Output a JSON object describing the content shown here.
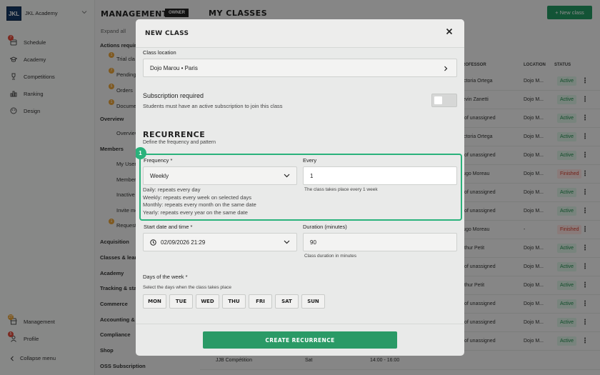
{
  "app": {
    "logo": "JKL",
    "name": "JKL Academy"
  },
  "sidebar": {
    "items": [
      {
        "label": "Schedule",
        "icon": "calendar-icon",
        "badge": "7"
      },
      {
        "label": "Academy",
        "icon": "graduation-cap-icon"
      },
      {
        "label": "Competitions",
        "icon": "trophy-icon"
      },
      {
        "label": "Ranking",
        "icon": "bar-chart-icon"
      },
      {
        "label": "Design",
        "icon": "palette-icon"
      }
    ],
    "bottom": [
      {
        "label": "Management",
        "icon": "store-icon",
        "badge": "27"
      },
      {
        "label": "Profile",
        "icon": "user-icon",
        "badge": "5"
      }
    ],
    "collapse": "Collapse menu"
  },
  "middle": {
    "title": "MANAGEMENT",
    "owner_badge": "OWNER",
    "expand": "Expand all",
    "sections": [
      {
        "label": "Actions required"
      },
      {
        "label": "Trial classes",
        "badge": "1"
      },
      {
        "label": "Pending",
        "badge": "7"
      },
      {
        "label": "Orders",
        "badge": "5"
      },
      {
        "label": "Documents",
        "badge": "1"
      },
      {
        "label": "Overview"
      },
      {
        "label": "Overview"
      },
      {
        "label": "Members"
      },
      {
        "label": "My Users"
      },
      {
        "label": "Members"
      },
      {
        "label": "Inactive members"
      },
      {
        "label": "Invite members"
      },
      {
        "label": "Requests",
        "badge": "1"
      },
      {
        "label": "Acquisition"
      },
      {
        "label": "Classes & learning"
      },
      {
        "label": "Academy"
      },
      {
        "label": "Tracking & stats"
      },
      {
        "label": "Commerce"
      },
      {
        "label": "Accounting & finance"
      },
      {
        "label": "Compliance"
      },
      {
        "label": "Shop"
      },
      {
        "label": "OSS Subscription"
      }
    ]
  },
  "main": {
    "title": "MY CLASSES",
    "new_button": "+ New class",
    "columns": [
      "PROFESSOR",
      "LOCATION",
      "STATUS"
    ],
    "rows": [
      {
        "prof": "Victoria Ortega",
        "loc": "Dojo M...",
        "status": "Active"
      },
      {
        "prof": "Kevin Zanetti",
        "loc": "Dojo M...",
        "status": "Active"
      },
      {
        "prof": "Prof unassigned",
        "loc": "Dojo M...",
        "status": "Active"
      },
      {
        "prof": "Victoria Ortega",
        "loc": "Dojo M...",
        "status": "Active"
      },
      {
        "prof": "Prof unassigned",
        "loc": "Dojo M...",
        "status": "Active"
      },
      {
        "prof": "Hugo Moreau",
        "loc": "Dojo M...",
        "status": "Finished"
      },
      {
        "prof": "Prof unassigned",
        "loc": "Dojo M...",
        "status": "Active"
      },
      {
        "prof": "Prof unassigned",
        "loc": "Dojo M...",
        "status": "Active"
      },
      {
        "prof": "Hugo Moreau",
        "loc": "-",
        "status": "Finished"
      },
      {
        "prof": "Arthur Petit",
        "loc": "Dojo M...",
        "status": "Active"
      },
      {
        "prof": "Prof unassigned",
        "loc": "Dojo M...",
        "status": "Active"
      },
      {
        "prof": "Arthur Petit",
        "loc": "Dojo M...",
        "status": "Active"
      },
      {
        "prof": "Prof unassigned",
        "loc": "Dojo M...",
        "status": "Active"
      },
      {
        "prof": "Prof unassigned",
        "loc": "Dojo M...",
        "status": "Active"
      },
      {
        "prof": "Prof unassigned",
        "loc": "Dojo M...",
        "status": "Active"
      }
    ],
    "last_row": {
      "name": "JJB Compétition",
      "day": "Sat",
      "time": "14:00 - 16:00"
    }
  },
  "modal": {
    "title": "NEW CLASS",
    "location_label": "Class location",
    "location_value": "Dojo Marou • Paris",
    "subscription_label": "Subscription required",
    "subscription_hint": "Students must have an active subscription to join this class",
    "recurrence_title": "RECURRENCE",
    "recurrence_sub": "Define the frequency and pattern",
    "step": "1",
    "frequency_label": "Frequency *",
    "frequency_value": "Weekly",
    "every_label": "Every",
    "every_value": "1",
    "every_hint": "The class takes place every 1 week",
    "freq_help": [
      "Daily: repeats every day",
      "Weekly: repeats every week on selected days",
      "Monthly: repeats every month on the same date",
      "Yearly: repeats every year on the same date"
    ],
    "start_label": "Start date and time *",
    "start_value": "02/09/2026 21:29",
    "duration_label": "Duration (minutes)",
    "duration_value": "90",
    "duration_hint": "Class duration in minutes",
    "days_label": "Days of the week *",
    "days_hint": "Select the days when the class takes place",
    "days": [
      "MON",
      "TUE",
      "WED",
      "THU",
      "FRI",
      "SAT",
      "SUN"
    ],
    "create_button": "CREATE RECURRENCE"
  },
  "colors": {
    "accent": "#239a63",
    "highlight": "#2ab27b",
    "logo": "#153a66",
    "active": "#1f8a4c",
    "finished": "#d23b2b"
  }
}
